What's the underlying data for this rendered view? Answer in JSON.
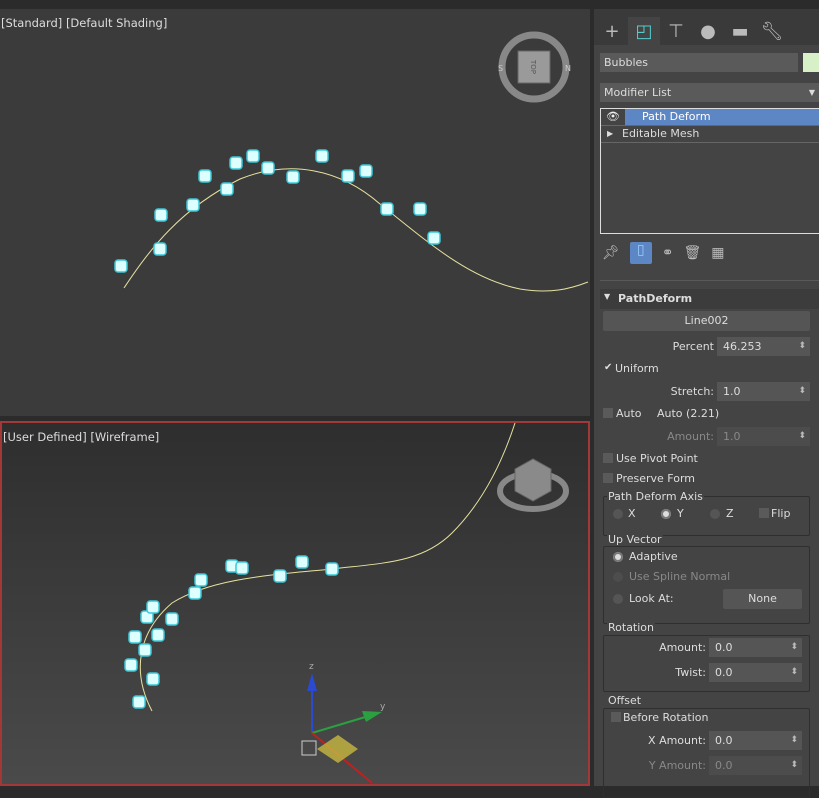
{
  "viewport_top": {
    "label": "[Standard] [Default Shading]",
    "viewcube": "TOP"
  },
  "viewport_bottom": {
    "label": "[User Defined] [Wireframe]",
    "gizmo_axes": [
      "z",
      "y",
      "x"
    ]
  },
  "panel": {
    "tabs": [
      {
        "icon": "plus-icon"
      },
      {
        "icon": "modify-icon",
        "active": true
      },
      {
        "icon": "hierarchy-icon"
      },
      {
        "icon": "motion-icon"
      },
      {
        "icon": "display-icon"
      },
      {
        "icon": "utilities-icon"
      }
    ],
    "object_name": "Bubbles",
    "object_color": "#d8f0c8",
    "modifier_list": "Modifier List",
    "stack": [
      {
        "label": "Path Deform",
        "selected": true
      },
      {
        "label": "Editable Mesh"
      }
    ],
    "rollout_title": "PathDeform",
    "path_button": "Line002",
    "percent_label": "Percent",
    "percent": "46.253",
    "uniform_label": "Uniform",
    "uniform": true,
    "stretch_label": "Stretch:",
    "stretch": "1.0",
    "auto_label": "Auto",
    "auto_value": "Auto (2.21)",
    "amount_label": "Amount:",
    "amount": "1.0",
    "use_pivot": "Use Pivot Point",
    "preserve_form": "Preserve Form",
    "axis_group": "Path Deform Axis",
    "axis_x": "X",
    "axis_y": "Y",
    "axis_z": "Z",
    "flip": "Flip",
    "axis_selected": "Y",
    "up_group": "Up Vector",
    "adaptive": "Adaptive",
    "spline_normal": "Use Spline Normal",
    "look_at": "Look At:",
    "look_at_btn": "None",
    "rotation_group": "Rotation",
    "rot_amount_label": "Amount:",
    "rot_amount": "0.0",
    "twist_label": "Twist:",
    "twist": "0.0",
    "offset_group": "Offset",
    "before_rotation": "Before Rotation",
    "x_amount_label": "X Amount:",
    "x_amount": "0.0",
    "y_amount_label": "Y Amount:",
    "y_amount": "0.0"
  }
}
